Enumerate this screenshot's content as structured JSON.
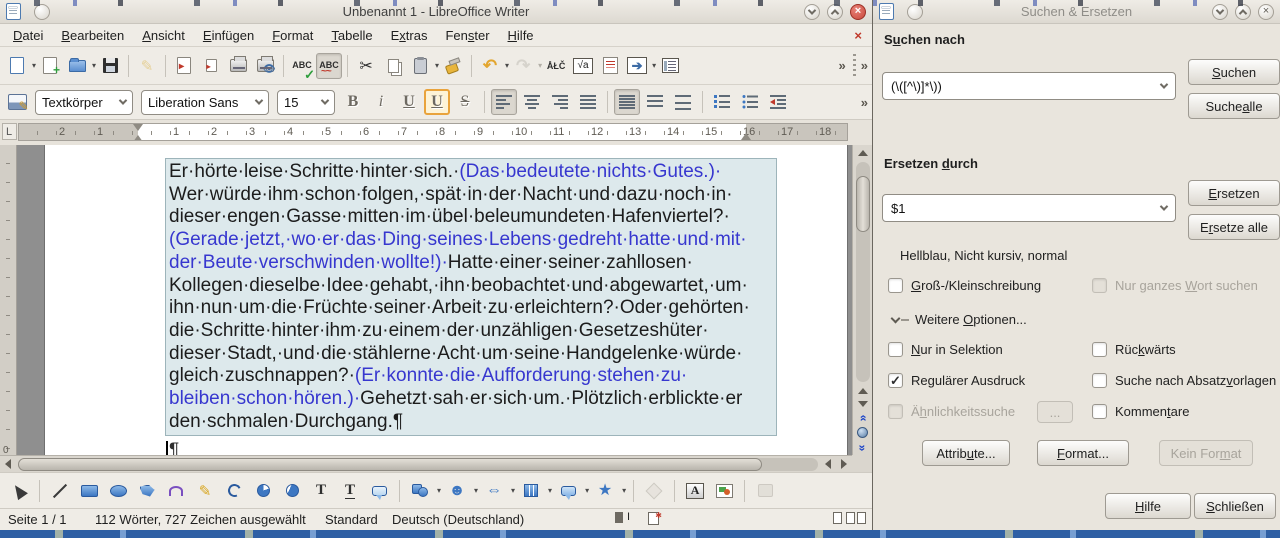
{
  "app": {
    "title": "Unbenannt 1 - LibreOffice Writer",
    "menu": [
      {
        "label": "Datei",
        "m": 0
      },
      {
        "label": "Bearbeiten",
        "m": 0
      },
      {
        "label": "Ansicht",
        "m": 0
      },
      {
        "label": "Einfügen",
        "m": 0
      },
      {
        "label": "Format",
        "m": 0
      },
      {
        "label": "Tabelle",
        "m": 0
      },
      {
        "label": "Extras",
        "m": 1
      },
      {
        "label": "Fenster",
        "m": 3
      },
      {
        "label": "Hilfe",
        "m": 0
      }
    ]
  },
  "toolbar": {
    "spellcheck_text": "ABC",
    "autospellcheck_text": "ABC",
    "special_chars_text": "ÅŁČ",
    "formula_text": "√a",
    "overflow_glyph": "»"
  },
  "formatting": {
    "style_combo": "Textkörper",
    "font_combo": "Liberation Sans",
    "size_combo": "15",
    "bold": "B",
    "italic": "i",
    "underline": "U",
    "underline2": "U",
    "strike": "S"
  },
  "ruler": {
    "left_marks": [
      "2",
      "1"
    ],
    "marks": [
      "1",
      "2",
      "3",
      "4",
      "5",
      "6",
      "7",
      "8",
      "9",
      "10",
      "11",
      "12",
      "13",
      "14",
      "15",
      "16",
      "17",
      "18"
    ],
    "vertical_zero": "0",
    "tab_selector": "L"
  },
  "document": {
    "lines": [
      [
        {
          "t": "Er·hörte·leise·Schritte·hinter·sich.·",
          "c": "k"
        },
        {
          "t": "(Das·bedeutete·nichts·Gutes.)·",
          "c": "b"
        }
      ],
      [
        {
          "t": "Wer·würde·ihm·schon·folgen,·spät·in·der·Nacht·und·dazu·noch·in·",
          "c": "k"
        }
      ],
      [
        {
          "t": "dieser·engen·Gasse·mitten·im·übel·beleumundeten·Hafenviertel?·",
          "c": "k"
        }
      ],
      [
        {
          "t": "(Gerade·jetzt,·wo·er·das·Ding·seines·Lebens·gedreht·hatte·und·mit·",
          "c": "b"
        }
      ],
      [
        {
          "t": "der·Beute·verschwinden·wollte!)·",
          "c": "b"
        },
        {
          "t": "Hatte·einer·seiner·zahllosen·",
          "c": "k"
        }
      ],
      [
        {
          "t": "Kollegen·dieselbe·Idee·gehabt,·ihn·beobachtet·und·abgewartet,·um·",
          "c": "k"
        }
      ],
      [
        {
          "t": "ihn·nun·um·die·Früchte·seiner·Arbeit·zu·erleichtern?·Oder·gehörten·",
          "c": "k"
        }
      ],
      [
        {
          "t": "die·Schritte·hinter·ihm·zu·einem·der·unzähligen·Gesetzeshüter·",
          "c": "k"
        }
      ],
      [
        {
          "t": "dieser·Stadt,·und·die·stählerne·Acht·um·seine·Handgelenke·würde·",
          "c": "k"
        }
      ],
      [
        {
          "t": "gleich·zuschnappen?·",
          "c": "k"
        },
        {
          "t": "(Er·konnte·die·Aufforderung·stehen·zu·",
          "c": "b"
        }
      ],
      [
        {
          "t": "bleiben·schon·hören.)·",
          "c": "b"
        },
        {
          "t": "Gehetzt·sah·er·sich·um.·Plötzlich·erblickte·er",
          "c": "k"
        }
      ],
      [
        {
          "t": "den·schmalen·Durchgang.¶",
          "c": "k"
        }
      ]
    ],
    "after_paragraph_mark": "¶",
    "text_black": "#1c1c1c",
    "text_blue": "#3737cf",
    "selection_bg": "#dde9ec"
  },
  "statusbar": {
    "page": "Seite 1 / 1",
    "words": "112 Wörter, 727 Zeichen ausgewählt",
    "style": "Standard",
    "language": "Deutsch (Deutschland)"
  },
  "dialog": {
    "title": "Suchen & Ersetzen",
    "search_label": {
      "label": "Suchen nach",
      "m": 1
    },
    "search_value": "(\\([^\\)]*\\))",
    "btn_search": {
      "label": "Suchen",
      "m": 0
    },
    "btn_search_all": {
      "label": "Suche alle",
      "m": 6
    },
    "replace_label": {
      "label": "Ersetzen durch",
      "m": 9
    },
    "replace_value": "$1",
    "btn_replace": {
      "label": "Ersetzen",
      "m": 0
    },
    "btn_replace_all": {
      "label": "Ersetze alle",
      "m": 1
    },
    "replace_format_note": "Hellblau, Nicht kursiv, normal",
    "expander": {
      "label": "Weitere Optionen...",
      "m": 8
    },
    "checkboxes": [
      {
        "label": "Groß-/Kleinschreibung",
        "m": 0,
        "checked": false,
        "disabled": false
      },
      {
        "label": "Nur ganzes Wort suchen",
        "m": 11,
        "checked": false,
        "disabled": true
      },
      {
        "label": "Nur in Selektion",
        "m": 0,
        "checked": false,
        "disabled": false
      },
      {
        "label": "Rückwärts",
        "m": 3,
        "checked": false,
        "disabled": false
      },
      {
        "label": "Regulärer Ausdruck",
        "m": -1,
        "checked": true,
        "disabled": false
      },
      {
        "label": "Suche nach Absatzvorlagen",
        "m": 17,
        "checked": false,
        "disabled": false
      },
      {
        "label": "Ähnlichkeitssuche",
        "m": 1,
        "checked": false,
        "disabled": true
      },
      {
        "label": "Kommentare",
        "m": 6,
        "checked": false,
        "disabled": false
      }
    ],
    "btn_similarity": "...",
    "btn_attributes": {
      "label": "Attribute...",
      "m": 6
    },
    "btn_format": {
      "label": "Format...",
      "m": 0
    },
    "btn_no_format": {
      "label": "Kein Format",
      "m": 8
    },
    "btn_help": {
      "label": "Hilfe",
      "m": 0
    },
    "btn_close": {
      "label": "Schließen",
      "m": 0
    }
  }
}
